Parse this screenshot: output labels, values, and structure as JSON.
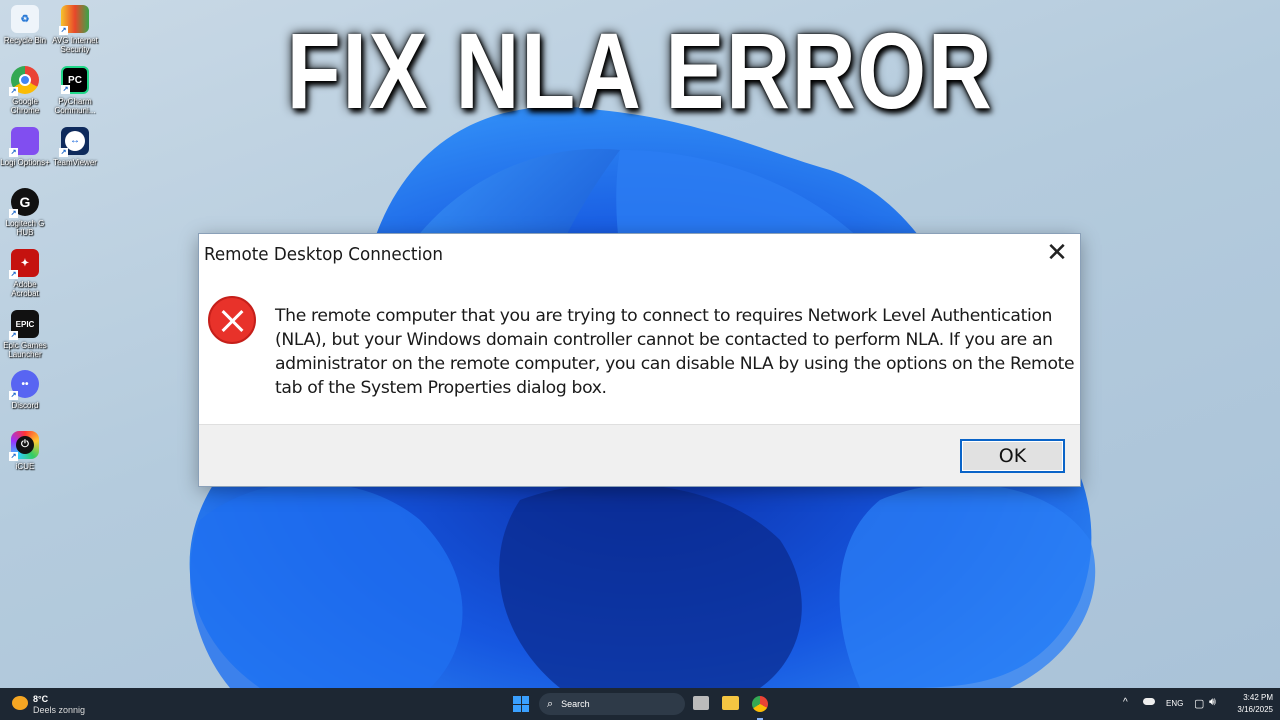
{
  "headline": "FIX NLA ERROR",
  "desktop_icons": [
    {
      "label": "Recycle Bin",
      "icon": "recycle-bin-icon"
    },
    {
      "label": "AVG Internet Security",
      "icon": "avg-icon"
    },
    {
      "label": "Google Chrome",
      "icon": "chrome-icon"
    },
    {
      "label": "PyCharm Communi...",
      "icon": "pycharm-icon",
      "glyph": "PC"
    },
    {
      "label": "Logi Options+",
      "icon": "logi-options-icon"
    },
    {
      "label": "TeamViewer",
      "icon": "teamviewer-icon"
    },
    {
      "label": "Logitech G HUB",
      "icon": "logitech-g-hub-icon",
      "glyph": "G"
    },
    {
      "label": "Adobe Acrobat",
      "icon": "adobe-acrobat-icon"
    },
    {
      "label": "Epic Games Launcher",
      "icon": "epic-games-icon",
      "glyph": "EPIC"
    },
    {
      "label": "Discord",
      "icon": "discord-icon"
    },
    {
      "label": "iCUE",
      "icon": "icue-icon"
    }
  ],
  "dialog": {
    "title": "Remote Desktop Connection",
    "message": "The remote computer that you are trying to connect to requires Network Level Authentication (NLA), but your Windows domain controller cannot be contacted to perform NLA. If you are an administrator on the remote computer, you can disable NLA by using the options on the Remote tab of the System Properties dialog box.",
    "ok_label": "OK",
    "close_glyph": "✕"
  },
  "taskbar": {
    "weather_temp": "8°C",
    "weather_text": "Deels zonnig",
    "search_label": "Search",
    "language": "ENG",
    "time": "3:42 PM",
    "date": "3/16/2025"
  }
}
